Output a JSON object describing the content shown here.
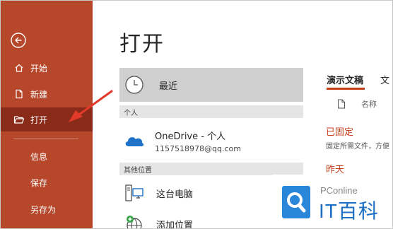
{
  "colors": {
    "sidebar_bg": "#b7472a",
    "sidebar_active_bg": "#8a2b1a",
    "accent": "#c43e1c",
    "annotation_arrow": "#e23a2a",
    "watermark_blue": "#2a86d8"
  },
  "sidebar": {
    "back_icon": "back-arrow-circle-icon",
    "items": [
      {
        "label": "开始",
        "icon": "home-icon"
      },
      {
        "label": "新建",
        "icon": "new-document-icon"
      },
      {
        "label": "打开",
        "icon": "open-folder-icon",
        "active": true
      },
      {
        "label": "信息"
      },
      {
        "label": "保存"
      },
      {
        "label": "另存为"
      }
    ]
  },
  "main": {
    "title": "打开",
    "locations": {
      "recent": {
        "label": "最近",
        "icon": "clock-icon"
      },
      "personal_header": "个人",
      "onedrive": {
        "title": "OneDrive - 个人",
        "account": "1157518978@qq.com",
        "icon": "cloud-icon"
      },
      "other_header": "其他位置",
      "this_pc": {
        "label": "这台电脑",
        "icon": "computer-icon"
      },
      "add_place": {
        "label": "添加位置",
        "icon": "globe-plus-icon"
      }
    },
    "files": {
      "tabs": [
        "演示文稿",
        "文"
      ],
      "name_column": "名称",
      "pinned_label": "已固定",
      "pinned_hint": "固定所需文件，方便",
      "yesterday_label": "昨天"
    }
  },
  "watermark": {
    "brand_top": "PConline",
    "brand_main": "IT百科"
  }
}
